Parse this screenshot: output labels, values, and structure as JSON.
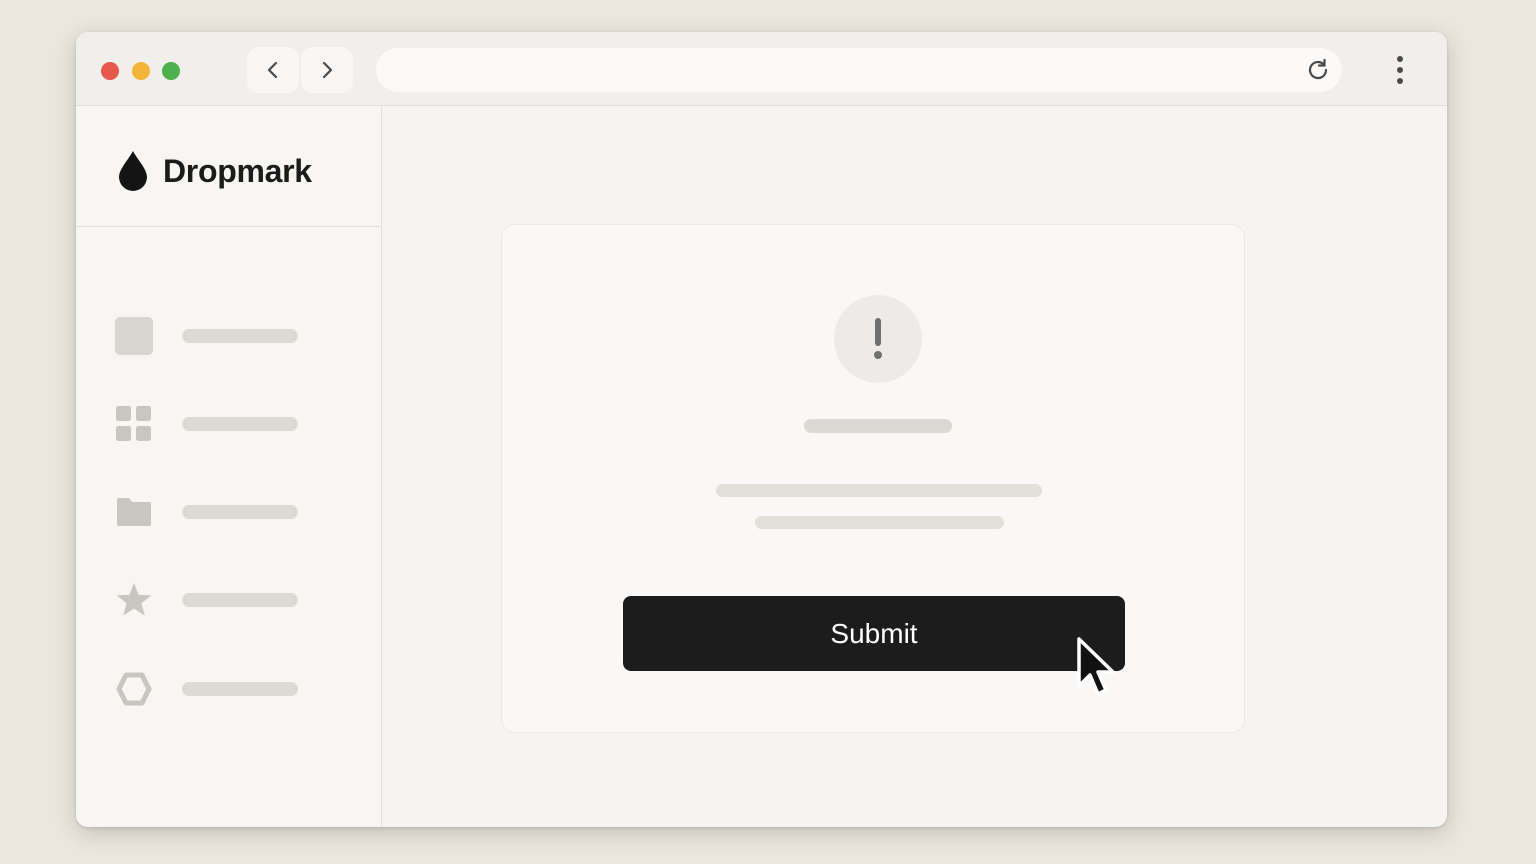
{
  "brand": {
    "name": "Dropmark",
    "logo_icon": "droplet-icon"
  },
  "browser": {
    "url": "",
    "controls": [
      "back-icon",
      "forward-icon",
      "reload-icon",
      "more-vertical-icon"
    ],
    "traffic_lights": [
      "#e5584b",
      "#f2b43a",
      "#4eb04d"
    ]
  },
  "sidebar": {
    "items": [
      {
        "icon": "square-icon"
      },
      {
        "icon": "grid-icon"
      },
      {
        "icon": "folder-icon"
      },
      {
        "icon": "star-icon"
      },
      {
        "icon": "hexagon-icon"
      }
    ]
  },
  "dialog": {
    "icon": "exclamation-icon",
    "submit_label": "Submit"
  },
  "colors": {
    "background": "#ece7de",
    "window": "#f6f4f1",
    "button": "#1c1c1c",
    "placeholder": "#dddad5"
  }
}
